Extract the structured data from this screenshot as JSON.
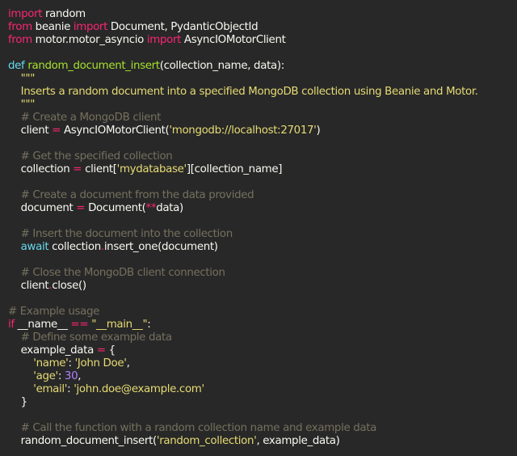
{
  "editor": {
    "background": "#282828",
    "colors": {
      "keyword": "#f92672",
      "function": "#a6e22e",
      "definition": "#66d9ef",
      "string": "#e6db74",
      "comment": "#75715e",
      "number": "#ae81ff",
      "operator": "#f92672",
      "identifier": "#f8f8f2"
    },
    "lines": [
      [
        {
          "t": "import",
          "c": "kw"
        },
        {
          "t": " random",
          "c": "id"
        }
      ],
      [
        {
          "t": "from",
          "c": "kw"
        },
        {
          "t": " beanie ",
          "c": "id"
        },
        {
          "t": "import",
          "c": "kw"
        },
        {
          "t": " Document, PydanticObjectId",
          "c": "id"
        }
      ],
      [
        {
          "t": "from",
          "c": "kw"
        },
        {
          "t": " motor.motor_asyncio ",
          "c": "id"
        },
        {
          "t": "import",
          "c": "kw"
        },
        {
          "t": " AsyncIOMotorClient",
          "c": "id"
        }
      ],
      [],
      [
        {
          "t": "def",
          "c": "def"
        },
        {
          "t": " ",
          "c": "id"
        },
        {
          "t": "random_document_insert",
          "c": "func"
        },
        {
          "t": "(collection_name, data):",
          "c": "id"
        }
      ],
      [
        {
          "t": "    \"\"\"",
          "c": "doc"
        }
      ],
      [
        {
          "t": "    Inserts a random document into a specified MongoDB collection using Beanie and Motor.",
          "c": "doc"
        }
      ],
      [
        {
          "t": "    \"\"\"",
          "c": "doc"
        }
      ],
      [
        {
          "t": "    # Create a MongoDB client",
          "c": "com"
        }
      ],
      [
        {
          "t": "    client ",
          "c": "id"
        },
        {
          "t": "=",
          "c": "op"
        },
        {
          "t": " AsyncIOMotorClient(",
          "c": "id"
        },
        {
          "t": "'mongodb://localhost:27017'",
          "c": "str"
        },
        {
          "t": ")",
          "c": "id"
        }
      ],
      [],
      [
        {
          "t": "    # Get the specified collection",
          "c": "com"
        }
      ],
      [
        {
          "t": "    collection ",
          "c": "id"
        },
        {
          "t": "=",
          "c": "op"
        },
        {
          "t": " client[",
          "c": "id"
        },
        {
          "t": "'mydatabase'",
          "c": "str"
        },
        {
          "t": "][collection_name]",
          "c": "id"
        }
      ],
      [],
      [
        {
          "t": "    # Create a document from the data provided",
          "c": "com"
        }
      ],
      [
        {
          "t": "    document ",
          "c": "id"
        },
        {
          "t": "=",
          "c": "op"
        },
        {
          "t": " Document(",
          "c": "id"
        },
        {
          "t": "**",
          "c": "op"
        },
        {
          "t": "data)",
          "c": "id"
        }
      ],
      [],
      [
        {
          "t": "    # Insert the document into the collection",
          "c": "com"
        }
      ],
      [
        {
          "t": "    ",
          "c": "id"
        },
        {
          "t": "await",
          "c": "def"
        },
        {
          "t": " collection",
          "c": "id"
        },
        {
          "t": ".",
          "c": "op"
        },
        {
          "t": "insert_one(document)",
          "c": "id"
        }
      ],
      [],
      [
        {
          "t": "    # Close the MongoDB client connection",
          "c": "com"
        }
      ],
      [
        {
          "t": "    client",
          "c": "id"
        },
        {
          "t": ".",
          "c": "op"
        },
        {
          "t": "close()",
          "c": "id"
        }
      ],
      [],
      [
        {
          "t": "# Example usage",
          "c": "com"
        }
      ],
      [
        {
          "t": "if",
          "c": "kw"
        },
        {
          "t": " __name__ ",
          "c": "id"
        },
        {
          "t": "==",
          "c": "op"
        },
        {
          "t": " ",
          "c": "id"
        },
        {
          "t": "\"__main__\"",
          "c": "str"
        },
        {
          "t": ":",
          "c": "id"
        }
      ],
      [
        {
          "t": "    # Define some example data",
          "c": "com"
        }
      ],
      [
        {
          "t": "    example_data ",
          "c": "id"
        },
        {
          "t": "=",
          "c": "op"
        },
        {
          "t": " {",
          "c": "id"
        }
      ],
      [
        {
          "t": "        ",
          "c": "id"
        },
        {
          "t": "'name'",
          "c": "str"
        },
        {
          "t": ": ",
          "c": "id"
        },
        {
          "t": "'John Doe'",
          "c": "str"
        },
        {
          "t": ",",
          "c": "id"
        }
      ],
      [
        {
          "t": "        ",
          "c": "id"
        },
        {
          "t": "'age'",
          "c": "str"
        },
        {
          "t": ": ",
          "c": "id"
        },
        {
          "t": "30",
          "c": "num"
        },
        {
          "t": ",",
          "c": "id"
        }
      ],
      [
        {
          "t": "        ",
          "c": "id"
        },
        {
          "t": "'email'",
          "c": "str"
        },
        {
          "t": ": ",
          "c": "id"
        },
        {
          "t": "'john.doe@example.com'",
          "c": "str"
        }
      ],
      [
        {
          "t": "    }",
          "c": "id"
        }
      ],
      [],
      [
        {
          "t": "    # Call the function with a random collection name and example data",
          "c": "com"
        }
      ],
      [
        {
          "t": "    random_document_insert(",
          "c": "id"
        },
        {
          "t": "'random_collection'",
          "c": "str"
        },
        {
          "t": ", example_data)",
          "c": "id"
        }
      ]
    ]
  }
}
